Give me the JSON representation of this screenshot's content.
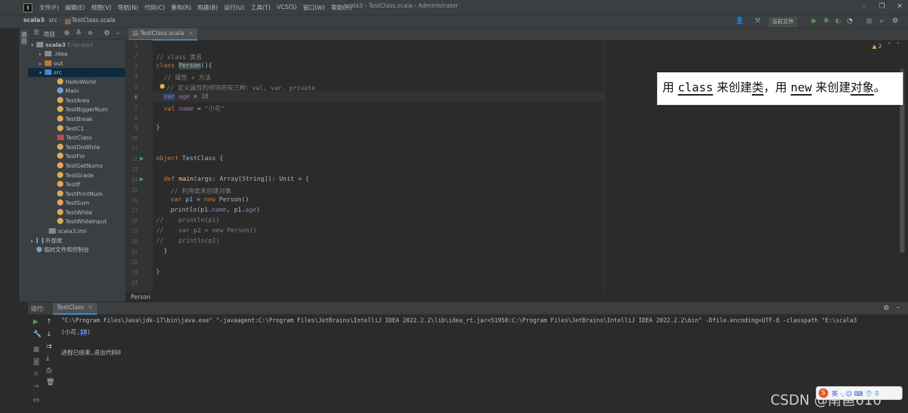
{
  "titlebar": {
    "menus": [
      "文件(F)",
      "编辑(E)",
      "视图(V)",
      "导航(N)",
      "代码(C)",
      "重构(R)",
      "构建(B)",
      "运行(U)",
      "工具(T)",
      "VCS(S)",
      "窗口(W)",
      "帮助(H)"
    ],
    "window_title": "scala3 - TestClass.scala - Administrator",
    "logo": "IJ"
  },
  "navbar": {
    "breadcrumbs": [
      "scala3",
      "src",
      "TestClass.scala"
    ],
    "run_config": "当前文件"
  },
  "project_panel": {
    "stripe_label": "项目",
    "title": "项目",
    "root": {
      "name": "scala3",
      "path": "E:\\scala3"
    },
    "items": [
      {
        "label": ".idea"
      },
      {
        "label": "out"
      },
      {
        "label": "src"
      },
      {
        "label": "HelloWorld"
      },
      {
        "label": "Main"
      },
      {
        "label": "TestArea"
      },
      {
        "label": "TestBiggerNum"
      },
      {
        "label": "TestBreak"
      },
      {
        "label": "TestC1"
      },
      {
        "label": "TestClass"
      },
      {
        "label": "TestDoWhile"
      },
      {
        "label": "TestFor"
      },
      {
        "label": "TestGetNums"
      },
      {
        "label": "TestGrade"
      },
      {
        "label": "TestIf"
      },
      {
        "label": "TestPrintNum"
      },
      {
        "label": "TestSum"
      },
      {
        "label": "TestWhile"
      },
      {
        "label": "TestWhileInput"
      },
      {
        "label": "scala3.iml"
      },
      {
        "label": "外部库"
      },
      {
        "label": "临时文件和控制台"
      }
    ]
  },
  "editor": {
    "tab": "TestClass.scala",
    "warning_count": "2",
    "line_numbers": [
      "1",
      "2",
      "3",
      "4",
      "5",
      "6",
      "7",
      "8",
      "9",
      "10",
      "11",
      "12",
      "13",
      "14",
      "15",
      "16",
      "17",
      "18",
      "19",
      "20",
      "21",
      "22",
      "23",
      "24"
    ],
    "code": {
      "c2": "// class 类名",
      "c4": "// 属性 + 方法",
      "c5": "// 定义属性的修饰符有三种：val, var, private",
      "l6_kw": "var",
      "l6_name": "age",
      "l6_rest": " = ",
      "l6_num": "18",
      "l7_kw": "val",
      "l7_name": "name",
      "l7_rest": " = ",
      "l7_str": "\"小花\"",
      "l3_kw": "class",
      "l3_name": "Person",
      "l3_rest": "(){",
      "l9": "}",
      "l12_kw": "object",
      "l12_rest": " TestClass {",
      "l14_kw": "def",
      "l14_fn": "main",
      "l14_rest": "(args: Array[String]): Unit = {",
      "c15": "// 利用类来创建对象",
      "l16_kw": "var",
      "l16_mid": " p1 = ",
      "l16_kw2": "new",
      "l16_rest": " Person()",
      "l17_fn": "println",
      "l17_a": "(p1.",
      "l17_b": "name",
      "l17_c": ", p1.",
      "l17_d": "age",
      "l17_e": ")",
      "c18": "//    println(p1)",
      "c19": "//    var p2 = new Person()",
      "c20": "//    println(p2)",
      "l21": "}",
      "l23": "}"
    },
    "footer_breadcrumb": "Person"
  },
  "annotation": {
    "p1": "用 ",
    "w1": "class",
    "p2": " 来创建",
    "w2": "类",
    "p3": "，用 ",
    "w3": "new",
    "p4": " 来创建",
    "w4": "对象",
    "p5": "。"
  },
  "run_panel": {
    "label": "运行:",
    "tab": "TestClass",
    "command": "\"C:\\Program Files\\Java\\jdk-17\\bin\\java.exe\" \"-javaagent:C:\\Program Files\\JetBrains\\IntelliJ IDEA 2022.2.2\\lib\\idea_rt.jar=51958:C:\\Program Files\\JetBrains\\IntelliJ IDEA 2022.2.2\\bin\" -Dfile.encoding=UTF-8 -classpath \"E:\\scala3",
    "output_open": "(小花,",
    "output_sel": "18",
    "output_close": ")",
    "exit_message": "进程已结束,退出代码0"
  },
  "watermark": "CSDN @南邕610",
  "ime": {
    "logo": "S",
    "text": "英 ·, ☺ ⌨ 👕 ⠿"
  }
}
